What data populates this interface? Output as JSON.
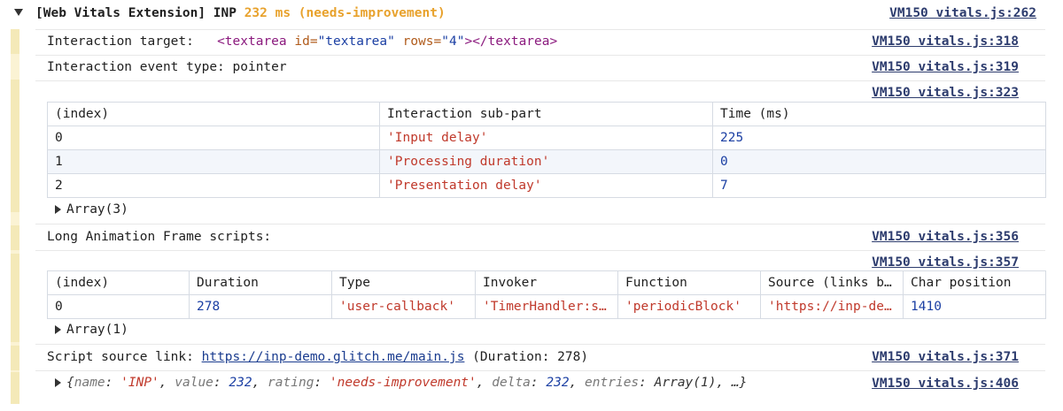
{
  "group": {
    "prefix": "[Web Vitals Extension] INP ",
    "value": "232 ms (needs-improvement)",
    "source": "VM150 vitals.js:262"
  },
  "rows": {
    "target": {
      "label": "Interaction target:   ",
      "tag_open": "<textarea",
      "attr1_name": " id=",
      "attr1_val": "\"textarea\"",
      "attr2_name": " rows=",
      "attr2_val": "\"4\"",
      "tag_close": "></textarea>",
      "source": "VM150 vitals.js:318"
    },
    "event_type": {
      "text": "Interaction event type: pointer",
      "source": "VM150 vitals.js:319"
    },
    "table1_source": "VM150 vitals.js:323",
    "loaf": {
      "text": "Long Animation Frame scripts:",
      "source": "VM150 vitals.js:356"
    },
    "table2_source": "VM150 vitals.js:357",
    "script_link": {
      "label": "Script source link: ",
      "url": "https://inp-demo.glitch.me/main.js",
      "suffix": " (Duration: 278)",
      "source": "VM150 vitals.js:371"
    },
    "object": {
      "source": "VM150 vitals.js:406",
      "open": "{",
      "k1": "name",
      "v1": "'INP'",
      "k2": "value",
      "v2": "232",
      "k3": "rating",
      "v3": "'needs-improvement'",
      "k4": "delta",
      "v4": "232",
      "k5": "entries",
      "v5": "Array(1), …}"
    }
  },
  "table1": {
    "headers": [
      "(index)",
      "Interaction sub-part",
      "Time (ms)"
    ],
    "rows": [
      [
        "0",
        "'Input delay'",
        "225"
      ],
      [
        "1",
        "'Processing duration'",
        "0"
      ],
      [
        "2",
        "'Presentation delay'",
        "7"
      ]
    ],
    "array_label": "Array(3)"
  },
  "table2": {
    "headers": [
      "(index)",
      "Duration",
      "Type",
      "Invoker",
      "Function",
      "Source (links b…",
      "Char position"
    ],
    "rows": [
      [
        "0",
        "278",
        "'user-callback'",
        "'TimerHandler:s…",
        "'periodicBlock'",
        "'https://inp-de…",
        "1410"
      ]
    ],
    "array_label": "Array(1)"
  },
  "colors": {
    "value_highlight": "#e8a22d",
    "string": "#c0392b",
    "number": "#1b3fa3",
    "gutter": "#fbf3d4"
  }
}
